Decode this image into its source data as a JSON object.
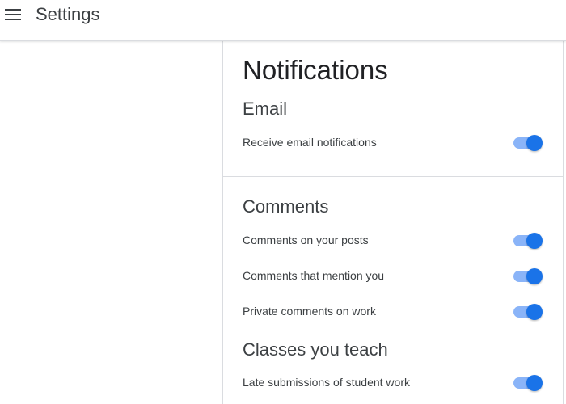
{
  "header": {
    "title": "Settings",
    "menu_icon": "hamburger-menu-icon"
  },
  "page": {
    "title": "Notifications"
  },
  "sections": {
    "email": {
      "heading": "Email",
      "items": [
        {
          "label": "Receive email notifications",
          "enabled": true
        }
      ]
    },
    "comments": {
      "heading": "Comments",
      "items": [
        {
          "label": "Comments on your posts",
          "enabled": true
        },
        {
          "label": "Comments that mention you",
          "enabled": true
        },
        {
          "label": "Private comments on work",
          "enabled": true
        }
      ]
    },
    "classes_you_teach": {
      "heading": "Classes you teach",
      "items": [
        {
          "label": "Late submissions of student work",
          "enabled": true
        }
      ]
    }
  },
  "colors": {
    "toggle_on_thumb": "#1a73e8",
    "toggle_on_track": "#8ab4f8",
    "divider": "#dadce0"
  }
}
